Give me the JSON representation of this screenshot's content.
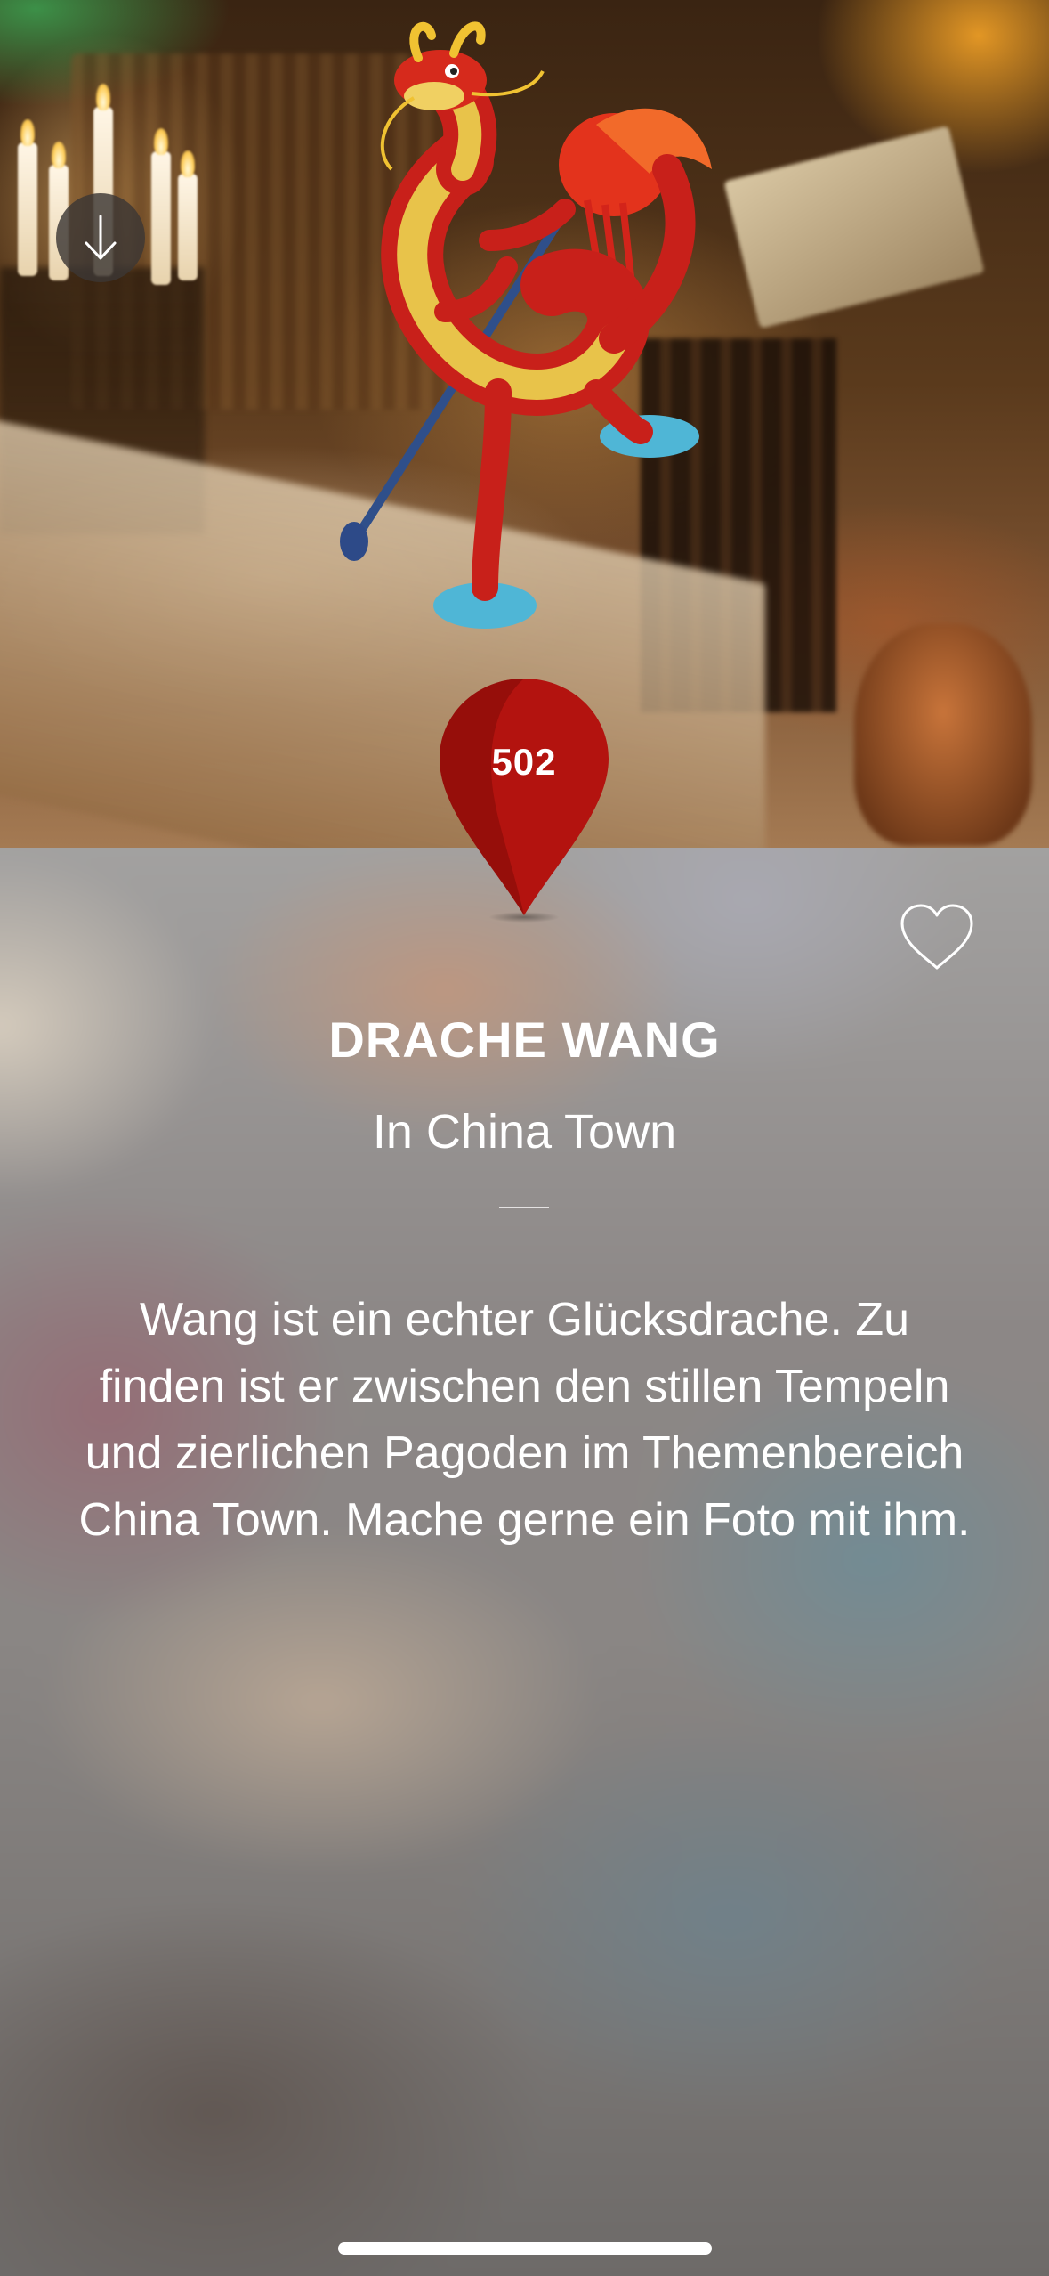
{
  "poi": {
    "number": "502",
    "title": "DRACHE WANG",
    "subtitle": "In China Town",
    "description": "Wang ist ein echter Glücksdrache. Zu finden ist er zwischen den stillen Tempeln und zierlichen Pagoden im Themenbereich China Town. Mache gerne ein Foto mit ihm."
  },
  "icons": {
    "download": "arrow-down-icon",
    "favorite": "heart-outline-icon",
    "pin": "map-pin-icon"
  },
  "colors": {
    "pin": "#b3130f",
    "pin_shade": "#8c0d0a",
    "text": "#ffffff"
  }
}
